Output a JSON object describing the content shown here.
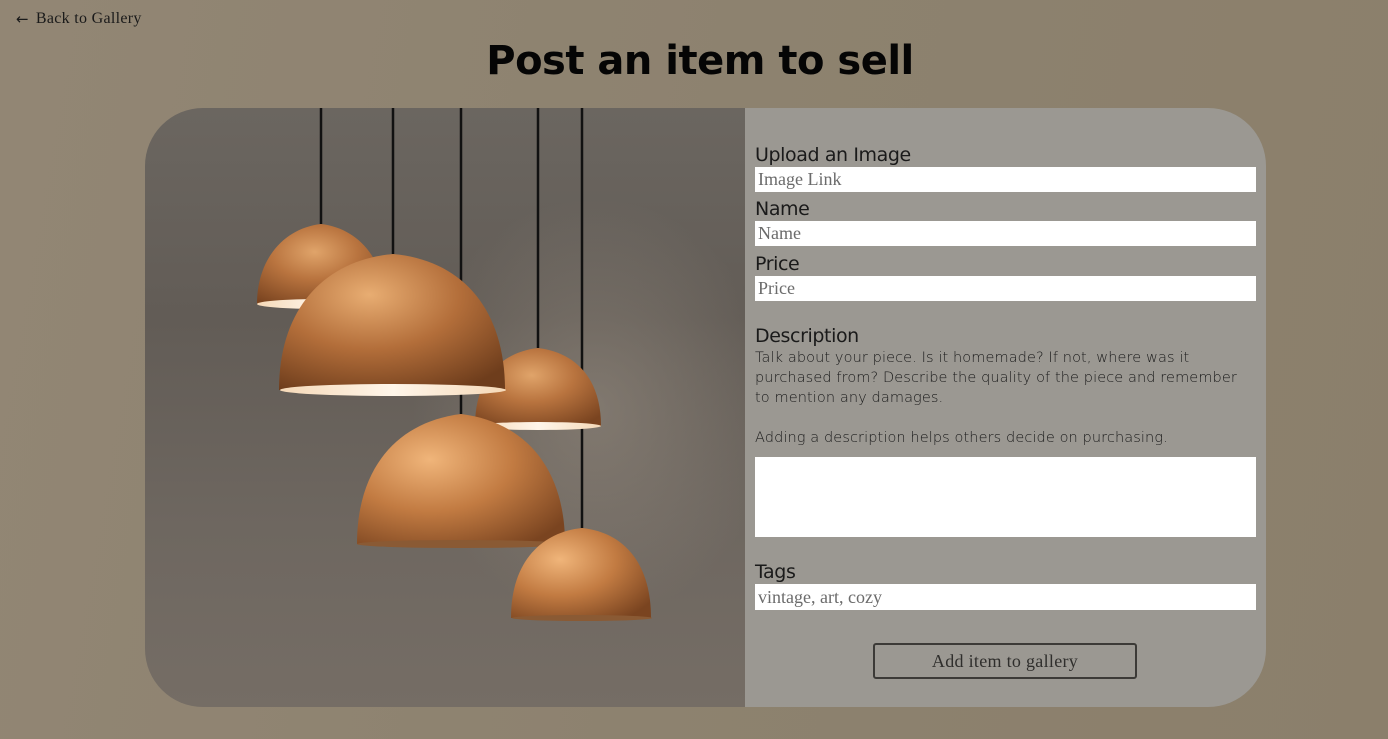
{
  "nav": {
    "back_arrow": "←",
    "back_label": "Back to Gallery"
  },
  "page": {
    "title": "Post an item to sell"
  },
  "form": {
    "image": {
      "label": "Upload an Image",
      "placeholder": "Image Link"
    },
    "name": {
      "label": "Name",
      "placeholder": "Name"
    },
    "price": {
      "label": "Price",
      "placeholder": "Price"
    },
    "description": {
      "label": "Description",
      "help_text": "Talk about your piece. Is it homemade? If not, where was it purchased from? Describe the quality of the piece and remember to mention any damages.",
      "help_text_2": "Adding a description helps others decide on purchasing.",
      "value": ""
    },
    "tags": {
      "label": "Tags",
      "placeholder": "vintage, art, cozy"
    },
    "submit_label": "Add item to gallery"
  },
  "colors": {
    "background": "#8d826f",
    "panel": "#9b9892",
    "copper": "#b8733e"
  },
  "image": {
    "subject": "copper pendant lamps"
  }
}
